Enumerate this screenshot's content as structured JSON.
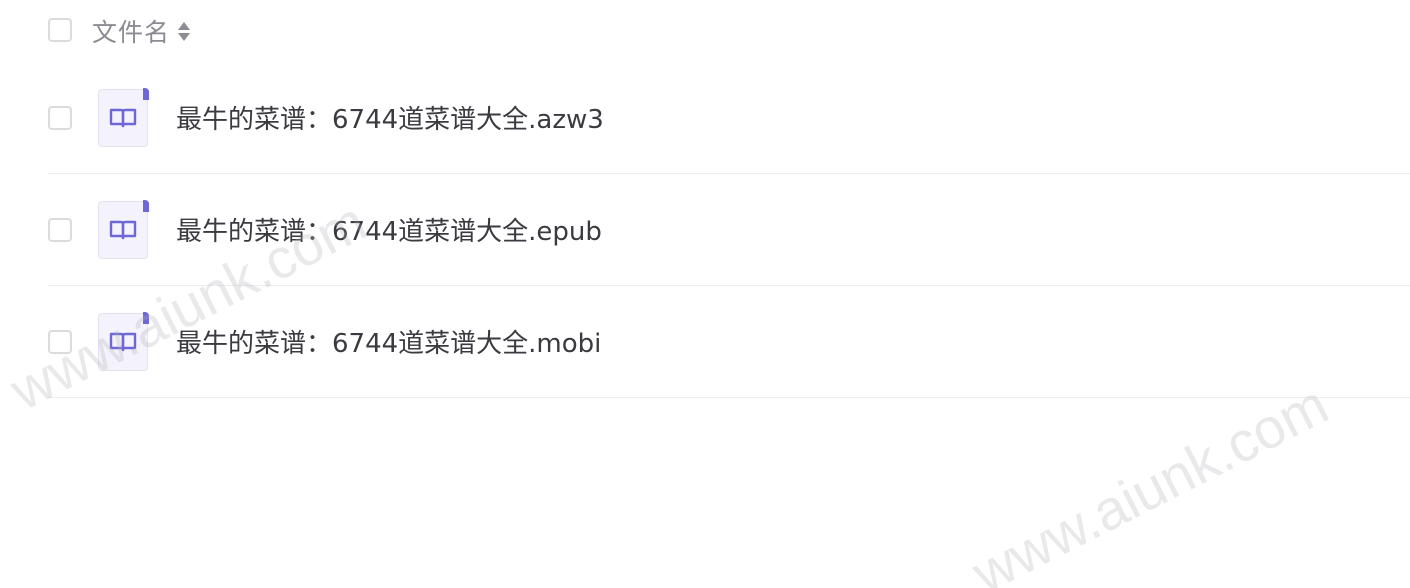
{
  "header": {
    "column_label": "文件名",
    "sort_icon": "sort-icon"
  },
  "files": [
    {
      "name": "最牛的菜谱：6744道菜谱大全.azw3",
      "icon": "book-icon"
    },
    {
      "name": "最牛的菜谱：6744道菜谱大全.epub",
      "icon": "book-icon"
    },
    {
      "name": "最牛的菜谱：6744道菜谱大全.mobi",
      "icon": "book-icon"
    }
  ],
  "watermarks": [
    "www.aiunk.com",
    "www.aiunk.com"
  ],
  "colors": {
    "accent": "#6e68d6",
    "icon_bg": "#f4f3fb",
    "text": "#3a3a40",
    "muted": "#8b8b93",
    "divider": "#efeff2"
  }
}
